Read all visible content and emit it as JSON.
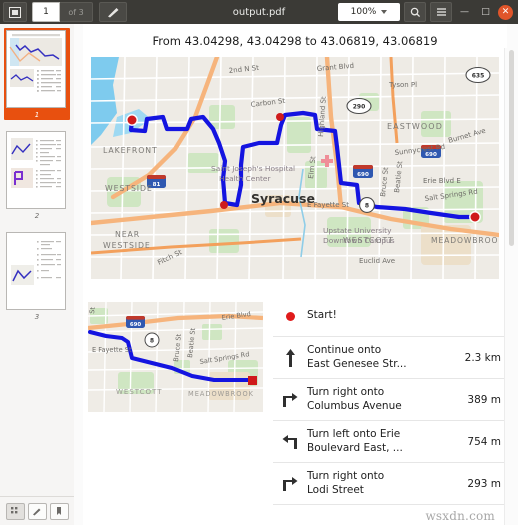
{
  "window": {
    "title": "output.pdf",
    "page_current": "1",
    "page_of": "of 3",
    "zoom": "100%",
    "sidebar_toggle_icon": "sidebar-toggle-icon",
    "pen_icon": "pen-icon",
    "search_icon": "search-icon",
    "menu_icon": "hamburger-menu-icon",
    "minimize_label": "—",
    "maximize_label": "□",
    "close_label": "✕",
    "accent_color": "#e8500f",
    "titlebar_color": "#3b3a36",
    "close_color": "#e0552a"
  },
  "sidebar": {
    "thumbnails": [
      {
        "number": "1",
        "selected": true
      },
      {
        "number": "2",
        "selected": false
      },
      {
        "number": "3",
        "selected": false
      }
    ],
    "bottom_buttons": [
      {
        "name": "thumbnails-view-button",
        "icon": "grid-icon",
        "active": true
      },
      {
        "name": "annotations-view-button",
        "icon": "pen-icon",
        "active": false
      },
      {
        "name": "bookmarks-view-button",
        "icon": "bookmark-icon",
        "active": false
      }
    ]
  },
  "document": {
    "title": "From 43.04298, 43.04298 to 43.06819, 43.06819",
    "watermark": "wsxdn.com",
    "route_color": "#1414e0",
    "marker_color": "#e01b1b"
  },
  "map_overview": {
    "place_labels": [
      "LAKEFRONT",
      "WESTSIDE",
      "NEAR WESTSIDE",
      "Syracuse",
      "EASTWOOD",
      "WESTCOTT",
      "MEADOWBROOK"
    ],
    "street_labels": [
      "2nd N St",
      "Grant Blvd",
      "Carbon St",
      "Tyson Pl",
      "Sunnycrest Rd",
      "Burnet Ave",
      "Highland St",
      "Elm St",
      "E Fayette St",
      "Erie Blvd E",
      "Bruce St",
      "Beatie St",
      "Salt Springs Rd",
      "Euclid Ave",
      "Fitch St"
    ],
    "poi_labels": [
      "Saint Joseph's Hospital Health Center",
      "Upstate University Downtown Campus"
    ],
    "shields": [
      "635",
      "290",
      "690",
      "690",
      "81",
      "8"
    ]
  },
  "map_detail": {
    "place_labels": [
      "WESTCOTT",
      "MEADOWBROOK"
    ],
    "street_labels": [
      "E Fayette St",
      "Erie Blvd",
      "Bruce St",
      "Beatie St",
      "Salt Springs Rd"
    ],
    "shields": [
      "690",
      "8"
    ]
  },
  "directions": [
    {
      "icon": "start-dot-icon",
      "text": "Start!",
      "distance": ""
    },
    {
      "icon": "arrow-straight-icon",
      "text": "Continue onto\nEast Genesee Str...",
      "distance": "2.3 km"
    },
    {
      "icon": "arrow-turn-right-icon",
      "text": "Turn right onto\nColumbus Avenue",
      "distance": "389 m"
    },
    {
      "icon": "arrow-turn-left-icon",
      "text": "Turn left onto Erie\nBoulevard East, ...",
      "distance": "754 m"
    },
    {
      "icon": "arrow-turn-right-icon",
      "text": "Turn right onto\nLodi Street",
      "distance": "293 m"
    }
  ]
}
